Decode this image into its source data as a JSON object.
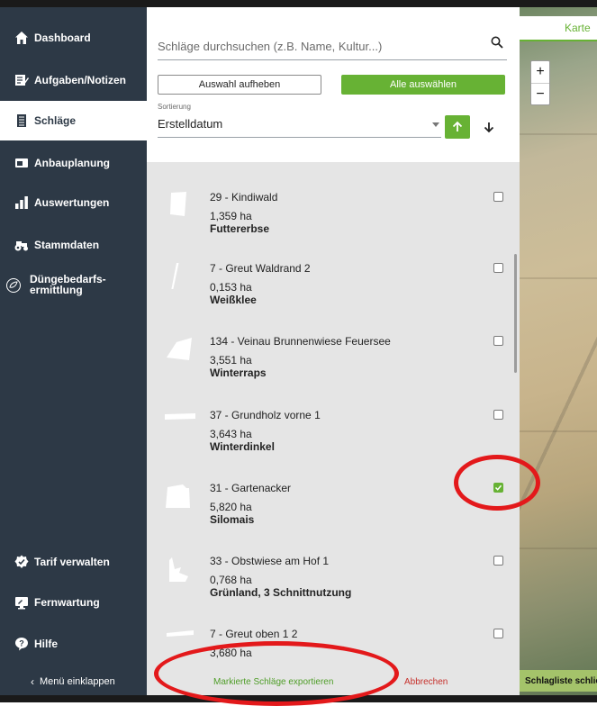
{
  "sidebar": {
    "items": [
      {
        "label": "Dashboard",
        "icon": "home-icon"
      },
      {
        "label": "Aufgaben/Notizen",
        "icon": "notes-icon"
      },
      {
        "label": "Schläge",
        "icon": "document-icon"
      },
      {
        "label": "Anbauplanung",
        "icon": "planning-icon"
      },
      {
        "label": "Auswertungen",
        "icon": "bar-chart-icon"
      },
      {
        "label": "Stammdaten",
        "icon": "tractor-icon"
      },
      {
        "label": "Düngebedarfs-",
        "label2": "ermittlung",
        "icon": "fertilizer-icon"
      }
    ],
    "bottom_items": [
      {
        "label": "Tarif verwalten",
        "icon": "badge-check-icon"
      },
      {
        "label": "Fernwartung",
        "icon": "remote-icon"
      },
      {
        "label": "Hilfe",
        "icon": "help-icon"
      }
    ],
    "collapse_label": "Menü einklappen"
  },
  "panel": {
    "search_placeholder": "Schläge durchsuchen (z.B. Name, Kultur...)",
    "deselect_label": "Auswahl aufheben",
    "select_all_label": "Alle auswählen",
    "sort_label": "Sortierung",
    "sort_value": "Erstelldatum",
    "fields": [
      {
        "name": "29 - Kindiwald",
        "area": "1,359 ha",
        "crop": "Futtererbse",
        "checked": false
      },
      {
        "name": "7 - Greut Waldrand 2",
        "area": "0,153 ha",
        "crop": "Weißklee",
        "checked": false
      },
      {
        "name": "134 - Veinau Brunnenwiese Feuersee",
        "area": "3,551 ha",
        "crop": "Winterraps",
        "checked": false
      },
      {
        "name": "37 - Grundholz vorne 1",
        "area": "3,643 ha",
        "crop": "Winterdinkel",
        "checked": false
      },
      {
        "name": "31 - Gartenacker",
        "area": "5,820 ha",
        "crop": "Silomais",
        "checked": true
      },
      {
        "name": "33 - Obstwiese am Hof 1",
        "area": "0,768 ha",
        "crop": "Grünland, 3 Schnittnutzung",
        "checked": false
      },
      {
        "name": "7 - Greut oben 1 2",
        "area": "3,680 ha",
        "crop": "",
        "checked": false
      }
    ],
    "export_label": "Markierte Schläge exportieren",
    "cancel_label": "Abbrechen"
  },
  "map": {
    "tab_label": "Karte",
    "zoom_in": "+",
    "zoom_out": "−",
    "list_button_label": "Schlagliste schließen"
  },
  "colors": {
    "sidebar_bg": "#2d3946",
    "accent_green": "#67b234",
    "list_bg": "#e5e5e5",
    "annotation_red": "#e3191b",
    "cancel_red": "#c6302b"
  }
}
